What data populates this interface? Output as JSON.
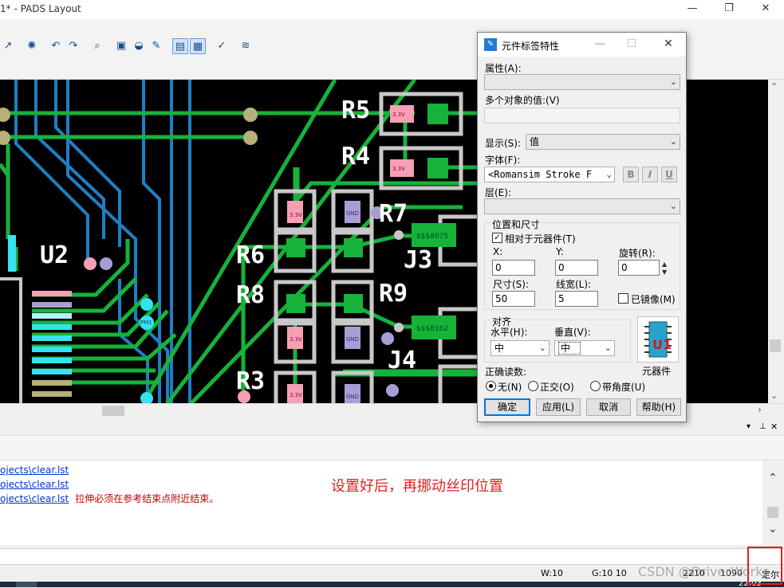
{
  "window": {
    "title": "1* - PADS Layout",
    "controls": [
      "—",
      "❐",
      "✕"
    ]
  },
  "toolbar": {
    "icons": [
      "route-icon",
      "via-icon",
      "undo-icon",
      "redo-icon",
      "zoom-icon",
      "view-icon",
      "layer-icon",
      "paint-icon",
      "select-icon",
      "display-icon",
      "drc-icon",
      "script-icon"
    ]
  },
  "canvas": {
    "ref_labels": [
      "U2",
      "R5",
      "R4",
      "R7",
      "R6",
      "R8",
      "R9",
      "J3",
      "J4",
      "R3"
    ],
    "pad_labels": [
      "3.3V",
      "3.3V",
      "3.3V",
      "3.3V",
      "3.3V",
      "GND",
      "GND",
      "GND",
      "PM1",
      "$$$8075",
      "$$$8162"
    ],
    "colors": {
      "background": "#000000",
      "trace": "#16b33a",
      "trace_blue": "#1f7fc4",
      "pad_white": "#c8c8c8",
      "pad_pink": "#f5a0b4",
      "pad_purple": "#a89ed6",
      "pad_olive": "#b8b078",
      "pad_cyan": "#36e2f0"
    }
  },
  "dialog": {
    "title": "元件标签特性",
    "attr_label": "属性(A):",
    "attr_value": "",
    "multi_label": "多个对象的值:(V)",
    "multi_value": "",
    "display_label": "显示(S):",
    "display_value": "值",
    "font_label": "字体(F):",
    "font_value": "<Romansim Stroke F",
    "font_buttons": [
      "B",
      "I",
      "U"
    ],
    "layer_label": "层(E):",
    "layer_value": "",
    "pos_group": "位置和尺寸",
    "relative_label": "相对于元器件(T)",
    "relative_checked": true,
    "x_label": "X:",
    "x_value": "0",
    "y_label": "Y:",
    "y_value": "0",
    "rot_label": "旋转(R):",
    "rot_value": "0",
    "size_label": "尺寸(S):",
    "size_value": "50",
    "width_label": "线宽(L):",
    "width_value": "5",
    "mirror_label": "已镜像(M)",
    "mirror_checked": false,
    "align_group": "对齐",
    "h_label": "水平(H):",
    "h_value": "中",
    "v_label": "垂直(V):",
    "v_value": "中",
    "comp_label": "元器件",
    "readable_label": "正确读数:",
    "radio_none": "无(N)",
    "radio_ortho": "正交(O)",
    "radio_angle": "带角度(U)",
    "btn_ok": "确定",
    "btn_apply": "应用(L)",
    "btn_cancel": "取消",
    "btn_help": "帮助(H)"
  },
  "output": {
    "lines": [
      {
        "link": "ojects\\clear.lst",
        "msg": ""
      },
      {
        "link": "ojects\\clear.lst",
        "msg": ""
      },
      {
        "link": "ojects\\clear.lst",
        "msg": "拉伸必须在参考结束点附近结束。"
      }
    ],
    "note": "设置好后，再挪动丝印位置"
  },
  "status": {
    "w": "W:10",
    "g": "G:10 10",
    "x": "2210",
    "y": "1090",
    "mode": "定尔"
  },
  "taskbar": {
    "clock": "22:03"
  },
  "watermark": "CSDN @DriverWorks"
}
